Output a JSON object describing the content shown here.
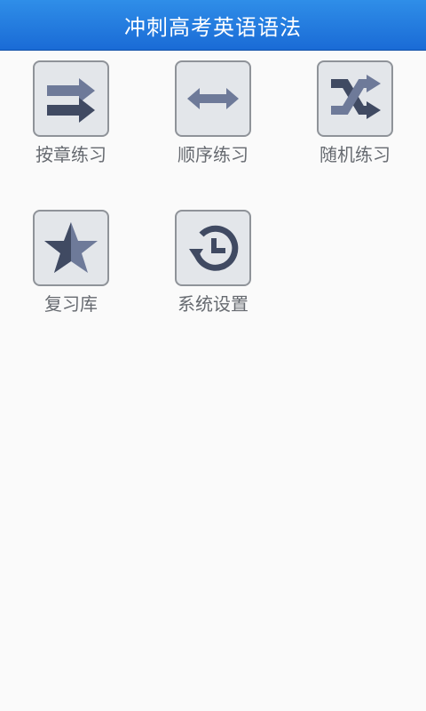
{
  "header": {
    "title": "冲刺高考英语语法"
  },
  "tiles": [
    {
      "label": "按章练习",
      "icon": "parallel-arrows-icon"
    },
    {
      "label": "顺序练习",
      "icon": "double-arrow-icon"
    },
    {
      "label": "随机练习",
      "icon": "shuffle-icon"
    },
    {
      "label": "复习库",
      "icon": "star-icon"
    },
    {
      "label": "系统设置",
      "icon": "history-icon"
    }
  ],
  "colors": {
    "header_blue": "#1f7ae0",
    "icon_dark": "#404a62",
    "icon_light": "#6e7a99",
    "tile_bg": "#e3e6ea",
    "label_gray": "#666a70"
  }
}
